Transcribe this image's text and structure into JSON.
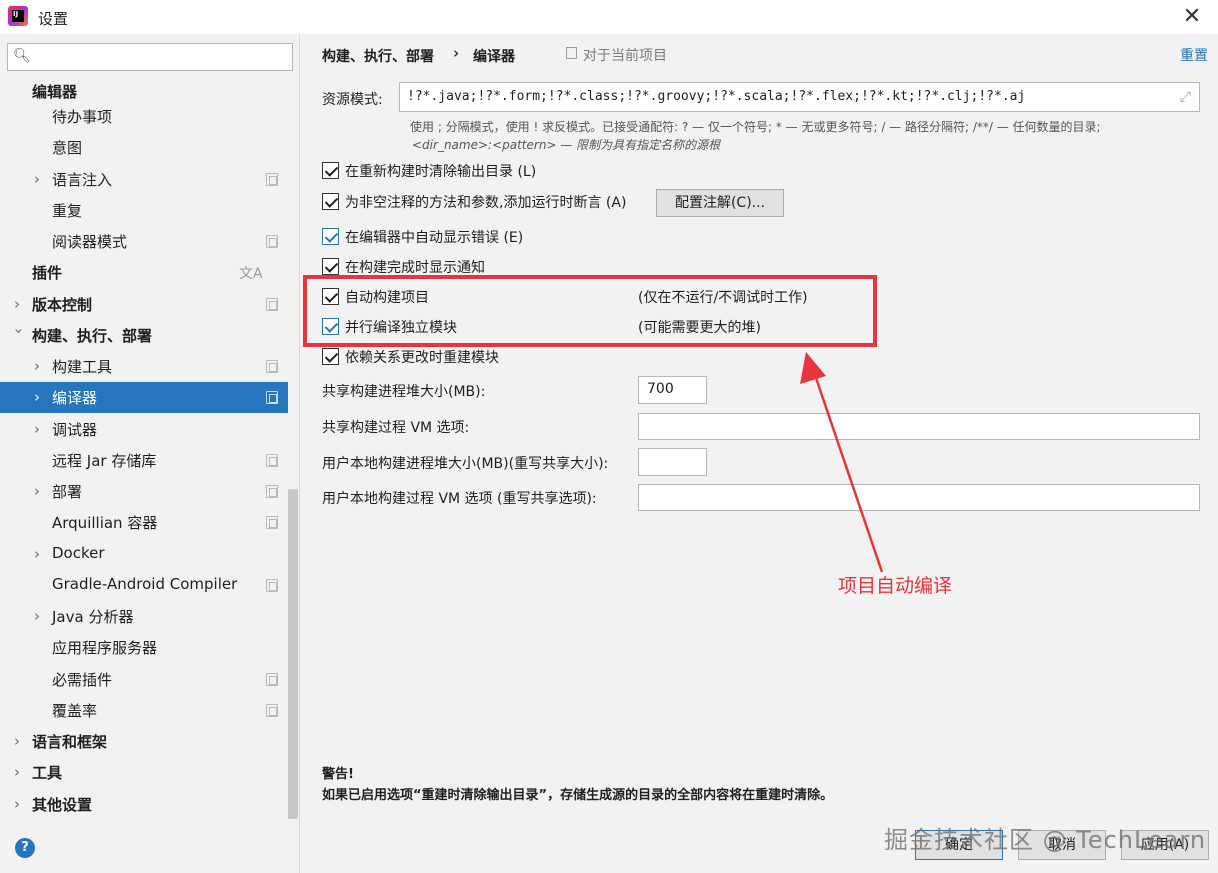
{
  "window": {
    "title": "设置"
  },
  "sidebar": {
    "search_placeholder": "",
    "items": [
      {
        "label": "编辑器"
      },
      {
        "label": "待办事项"
      },
      {
        "label": "意图"
      },
      {
        "label": "语言注入"
      },
      {
        "label": "重复"
      },
      {
        "label": "阅读器模式"
      },
      {
        "label": "插件"
      },
      {
        "label": "版本控制"
      },
      {
        "label": "构建、执行、部署"
      },
      {
        "label": "构建工具"
      },
      {
        "label": "编译器"
      },
      {
        "label": "调试器"
      },
      {
        "label": "远程 Jar 存储库"
      },
      {
        "label": "部署"
      },
      {
        "label": "Arquillian 容器"
      },
      {
        "label": "Docker"
      },
      {
        "label": "Gradle-Android Compiler"
      },
      {
        "label": "Java 分析器"
      },
      {
        "label": "应用程序服务器"
      },
      {
        "label": "必需插件"
      },
      {
        "label": "覆盖率"
      },
      {
        "label": "语言和框架"
      },
      {
        "label": "工具"
      },
      {
        "label": "其他设置"
      }
    ],
    "selected": "编译器"
  },
  "header": {
    "breadcrumb_parent": "构建、执行、部署",
    "breadcrumb_current": "编译器",
    "project_scope": "对于当前项目",
    "reset": "重置"
  },
  "resources": {
    "label": "资源模式:",
    "value": "!?*.java;!?*.form;!?*.class;!?*.groovy;!?*.scala;!?*.flex;!?*.kt;!?*.clj;!?*.aj",
    "hint_line1": "使用 ; 分隔模式，使用 ! 求反模式。已接受通配符: ? — 仅一个符号; * — 无或更多符号; / — 路径分隔符; /**/ — 任何数量的目录;",
    "hint_line2": "<dir_name>:<pattern> — 限制为具有指定名称的源根"
  },
  "options": [
    {
      "label": "在重新构建时清除输出目录 (L)",
      "checked": true
    },
    {
      "label": "为非空注释的方法和参数,添加运行时断言 (A)",
      "checked": true
    },
    {
      "label": "在编辑器中自动显示错误 (E)",
      "checked": true
    },
    {
      "label": "在构建完成时显示通知",
      "checked": true
    },
    {
      "label": "自动构建项目",
      "checked": true,
      "note": "(仅在不运行/不调试时工作)"
    },
    {
      "label": "并行编译独立模块",
      "checked": true,
      "note": "(可能需要更大的堆)"
    },
    {
      "label": "依赖关系更改时重建模块",
      "checked": true
    }
  ],
  "configure_annotations_button": "配置注解(C)...",
  "fields": {
    "shared_heap_label": "共享构建进程堆大小(MB):",
    "shared_heap_value": "700",
    "shared_vm_label": "共享构建过程 VM 选项:",
    "shared_vm_value": "",
    "user_heap_label": "用户本地构建进程堆大小(MB)(重写共享大小):",
    "user_heap_value": "",
    "user_vm_label": "用户本地构建过程 VM 选项 (重写共享选项):",
    "user_vm_value": ""
  },
  "annotation": {
    "text": "项目自动编译",
    "color": "#e8343c"
  },
  "warning": {
    "title": "警告!",
    "text": "如果已启用选项“重建时清除输出目录”，存储生成源的目录的全部内容将在重建时清除。"
  },
  "footer": {
    "ok": "确定",
    "cancel": "取消",
    "apply": "应用(A)"
  },
  "watermark": "掘金技术社区 @ TechLearn",
  "colors": {
    "accent": "#2675bf",
    "selection": "#2675bf",
    "highlight": "#e8343c"
  }
}
